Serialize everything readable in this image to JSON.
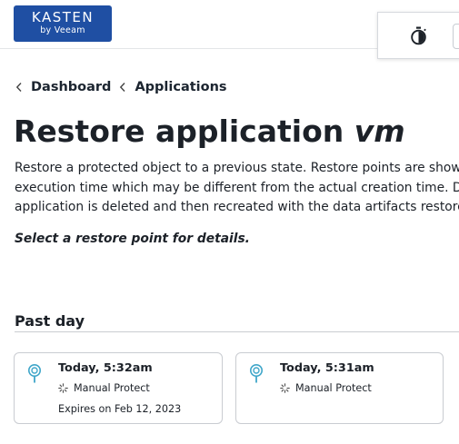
{
  "header": {
    "logo": {
      "main": "KASTEN",
      "sub": "by Veeam"
    },
    "icons": {
      "timer": "stopwatch-icon"
    }
  },
  "breadcrumb": {
    "items": [
      {
        "label": "Dashboard"
      },
      {
        "label": "Applications"
      }
    ]
  },
  "page": {
    "title_prefix": "Restore application ",
    "app_name": "vm",
    "description_lines": [
      "Restore a protected object to a previous state. Restore points are shown a",
      "execution time which may be different from the actual creation time. Duri",
      "application is deleted and then recreated with the data artifacts restored f"
    ],
    "hint": "Select a restore point for details."
  },
  "sections": [
    {
      "title": "Past day",
      "restore_points": [
        {
          "time": "Today, 5:32am",
          "policy": "Manual Protect",
          "expiry": "Expires on Feb 12, 2023"
        },
        {
          "time": "Today, 5:31am",
          "policy": "Manual Protect",
          "expiry": ""
        }
      ]
    }
  ],
  "colors": {
    "brand": "#1f4fa3",
    "pin": "#3fa6c9",
    "border": "#c9ccd1",
    "text": "#1c2128"
  }
}
